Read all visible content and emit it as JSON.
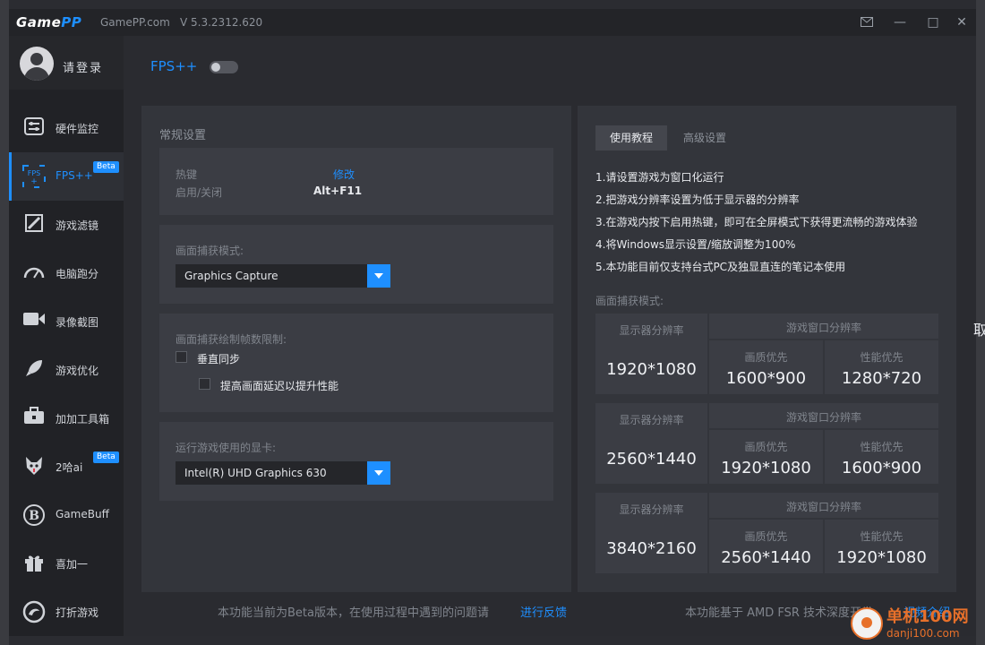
{
  "app": {
    "logo_left": "Game",
    "logo_right": "PP",
    "site": "GamePP.com",
    "version": "V 5.3.2312.620"
  },
  "window_controls": {
    "mail_icon": "mail-icon",
    "minimize": "—",
    "restore": "□",
    "close": "✕"
  },
  "user": {
    "login_label": "请登录"
  },
  "sidebar": {
    "items": [
      {
        "label": "硬件监控",
        "icon": "hardware-monitor-icon",
        "glyph": "⚙"
      },
      {
        "label": "FPS++",
        "icon": "fps-icon",
        "glyph": "FPS",
        "badge": "Beta"
      },
      {
        "label": "游戏滤镜",
        "icon": "filter-icon",
        "glyph": "◩"
      },
      {
        "label": "电脑跑分",
        "icon": "gauge-icon",
        "glyph": "◔"
      },
      {
        "label": "录像截图",
        "icon": "camera-icon",
        "glyph": "■"
      },
      {
        "label": "游戏优化",
        "icon": "rocket-icon",
        "glyph": "➶"
      },
      {
        "label": "加加工具箱",
        "icon": "toolbox-icon",
        "glyph": "▣"
      },
      {
        "label": "2哈ai",
        "icon": "husky-icon",
        "glyph": "◈",
        "badge": "Beta"
      },
      {
        "label": "GameBuff",
        "icon": "gamebuff-icon",
        "glyph": "B"
      },
      {
        "label": "喜加一",
        "icon": "gift-icon",
        "glyph": "▦"
      },
      {
        "label": "打折游戏",
        "icon": "discount-icon",
        "glyph": "◎"
      }
    ]
  },
  "header": {
    "title": "FPS++",
    "toggle_on": false
  },
  "general": {
    "section_title": "常规设置",
    "hotkey_label": "热键",
    "toggle_label": "启用/关闭",
    "edit_link": "修改",
    "hotkey_value": "Alt+F11",
    "capture_mode_label": "画面捕获模式:",
    "capture_mode_value": "Graphics Capture",
    "frame_limit_label": "画面捕获绘制帧数限制:",
    "vsync_label": "垂直同步",
    "latency_label": "提高画面延迟以提升性能",
    "gpu_label": "运行游戏使用的显卡:",
    "gpu_value": "Intel(R) UHD Graphics 630"
  },
  "tutorial": {
    "tab_usage": "使用教程",
    "tab_advanced": "高级设置",
    "steps": [
      "1.请设置游戏为窗口化运行",
      "2.把游戏分辨率设置为低于显示器的分辨率",
      "3.在游戏内按下启用热键，即可在全屏模式下获得更流畅的游戏体验",
      "4.将Windows显示设置/缩放调整为100%",
      "5.本功能目前仅支持台式PC及独显直连的笔记本使用"
    ],
    "capture_mode_label": "画面捕获模式:",
    "table": [
      {
        "monitor_label": "显示器分辨率",
        "monitor": "1920*1080",
        "window_label": "游戏窗口分辨率",
        "quality_label": "画质优先",
        "quality": "1600*900",
        "perf_label": "性能优先",
        "perf": "1280*720"
      },
      {
        "monitor_label": "显示器分辨率",
        "monitor": "2560*1440",
        "window_label": "游戏窗口分辨率",
        "quality_label": "画质优先",
        "quality": "1920*1080",
        "perf_label": "性能优先",
        "perf": "1600*900"
      },
      {
        "monitor_label": "显示器分辨率",
        "monitor": "3840*2160",
        "window_label": "游戏窗口分辨率",
        "quality_label": "画质优先",
        "quality": "2560*1440",
        "perf_label": "性能优先",
        "perf": "1920*1080"
      }
    ]
  },
  "footer": {
    "beta_note": "本功能当前为Beta版本，在使用过程中遇到的问题请",
    "feedback_link": "进行反馈",
    "fsr_note": "本功能基于 AMD FSR 技术深度开发",
    "video_link": "视频介绍"
  },
  "edge_char": "取",
  "watermark": {
    "name": "单机100网",
    "domain": "danji100.com"
  },
  "colors": {
    "accent": "#1e8fff",
    "watermark": "#e7702a"
  }
}
